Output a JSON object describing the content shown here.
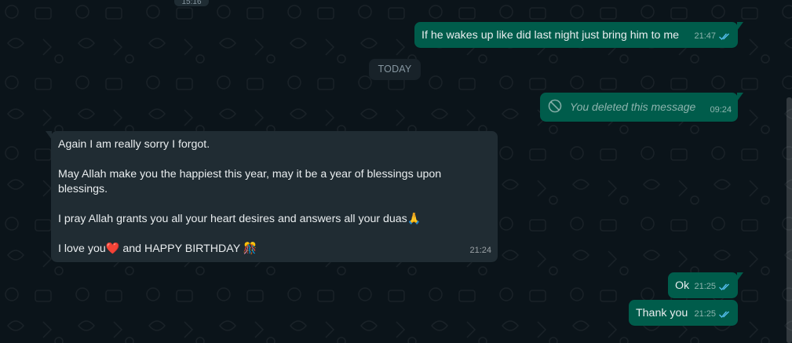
{
  "top_stub_time": "15:16",
  "date_divider": "TODAY",
  "messages": [
    {
      "text": "If he wakes up like did last night just bring him to me",
      "time": "21:47"
    },
    {
      "text": "You deleted this message",
      "time": "09:24"
    },
    {
      "lines": [
        "Again I am really sorry I forgot.",
        "May Allah make you the happiest this year, may it be a year of blessings upon blessings.",
        "I pray Allah grants you all your heart desires and answers all your duas🙏",
        "I love you❤️ and HAPPY BIRTHDAY 🎊"
      ],
      "time": "21:24"
    },
    {
      "text": "Ok",
      "time": "21:25"
    },
    {
      "text": "Thank you",
      "time": "21:25"
    }
  ],
  "icons": {
    "read_ticks": "double-check-icon",
    "deleted": "blocked-circle-icon"
  },
  "colors": {
    "outgoing_bubble": "#005c4b",
    "incoming_bubble": "#202c33",
    "background": "#0b141a",
    "read_tick": "#53bdeb"
  }
}
